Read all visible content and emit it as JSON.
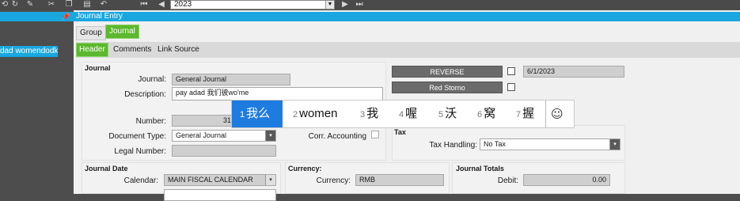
{
  "toolbar": {
    "icons": [
      "history-icon",
      "refresh-icon",
      "clear-icon",
      "cut-icon",
      "copy-icon",
      "paste-icon",
      "undo-icon",
      "first-record-icon",
      "previous-record-icon",
      "next-record-icon",
      "last-record-icon"
    ],
    "year_value": "2023"
  },
  "left": {
    "selected_item": "dad womendodko"
  },
  "window": {
    "title": "Journal Entry"
  },
  "tabs": [
    {
      "label": "Group"
    },
    {
      "label": "Journal"
    }
  ],
  "subtabs": [
    {
      "label": "Header"
    },
    {
      "label": "Comments"
    },
    {
      "label": "Link Source"
    }
  ],
  "journal": {
    "section": "Journal",
    "journal_label": "Journal:",
    "journal_value": "General Journal",
    "description_label": "Description:",
    "description_value": "pay adad 我们彼wo'me",
    "number_label": "Number:",
    "number_value": "31",
    "doctype_label": "Document Type:",
    "doctype_value": "General Journal",
    "corr_label": "Corr. Accounting",
    "legal_label": "Legal Number:",
    "legal_value": ""
  },
  "reverse": {
    "reverse_label": "REVERSE",
    "redstorno_label": "Red Storno",
    "date_value": "6/1/2023"
  },
  "tax": {
    "section": "Tax",
    "handling_label": "Tax Handling:",
    "handling_value": "No Tax"
  },
  "journal_date": {
    "section": "Journal Date",
    "calendar_label": "Calendar:",
    "calendar_value": "MAIN FISCAL CALENDAR"
  },
  "currency": {
    "section": "Currency:",
    "currency_label": "Currency:",
    "currency_value": "RMB"
  },
  "totals": {
    "section": "Journal Totals",
    "debit_label": "Debit:",
    "debit_value": "0.00"
  },
  "ime": {
    "candidates": [
      {
        "num": "1",
        "text": "我么"
      },
      {
        "num": "2",
        "text": "women"
      },
      {
        "num": "3",
        "text": "我"
      },
      {
        "num": "4",
        "text": "喔"
      },
      {
        "num": "5",
        "text": "沃"
      },
      {
        "num": "6",
        "text": "窝"
      },
      {
        "num": "7",
        "text": "握"
      }
    ],
    "emoji_icon": "smiley-icon"
  }
}
